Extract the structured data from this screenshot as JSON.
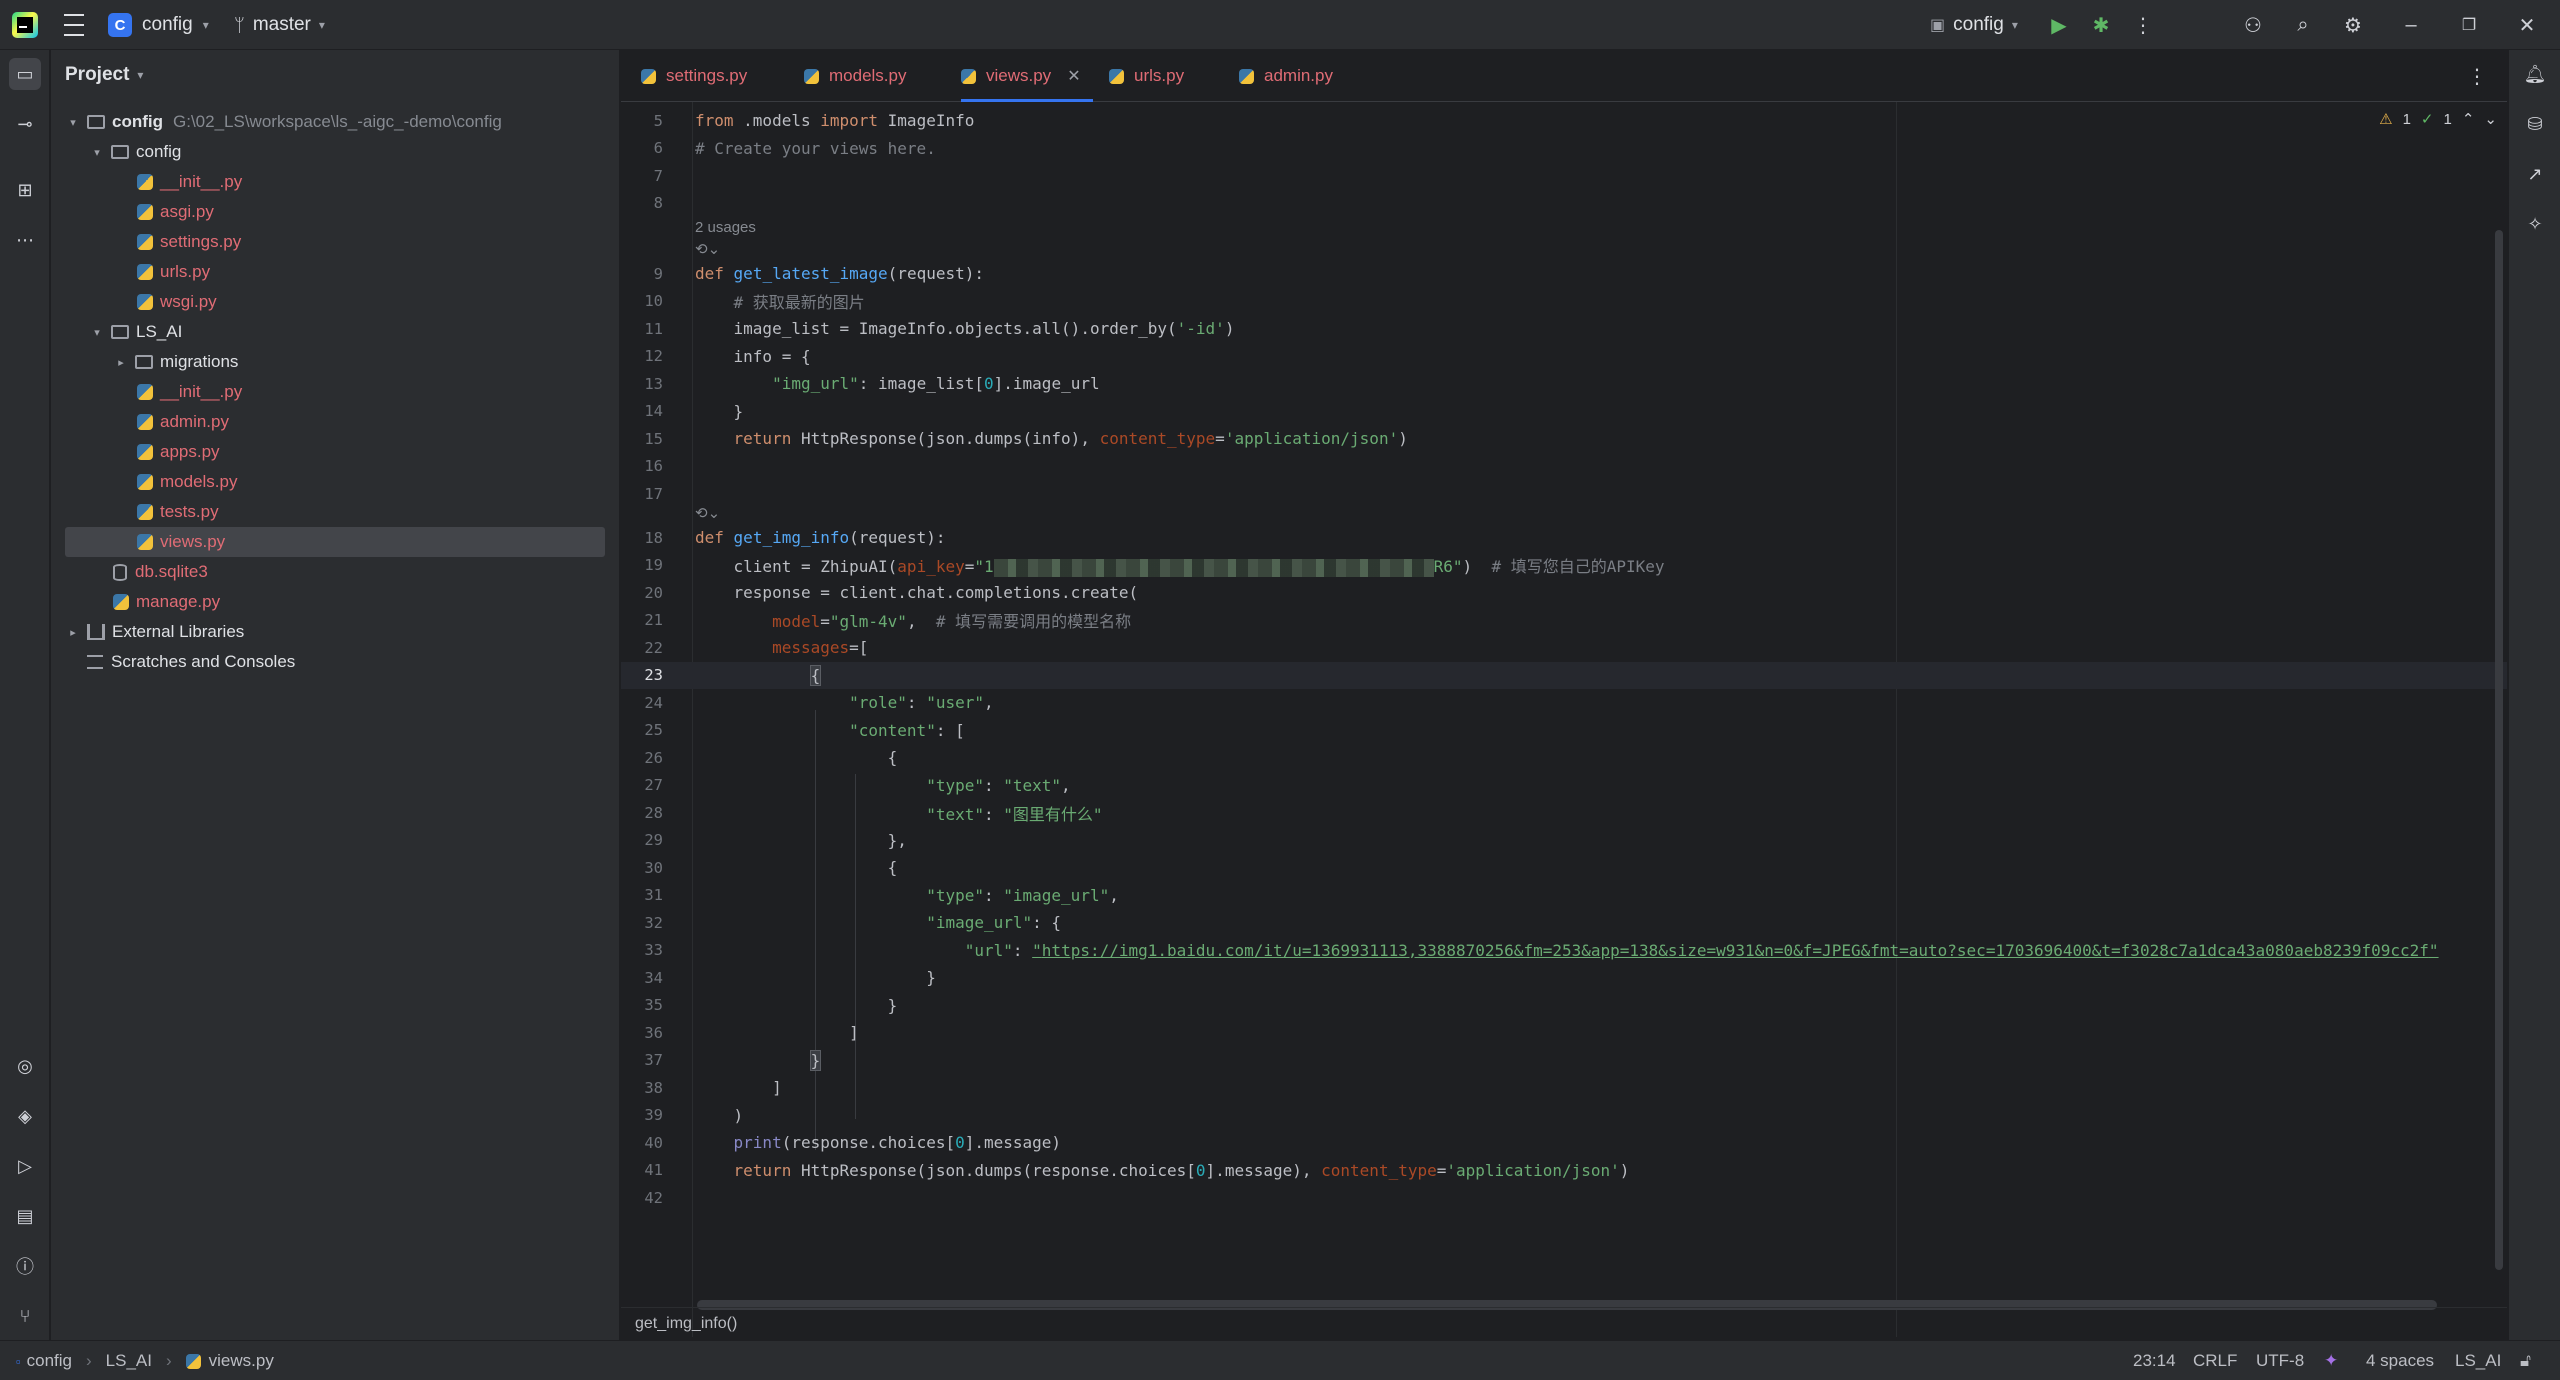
{
  "titlebar": {
    "project_badge": "C",
    "project_name": "config",
    "branch": "master",
    "run_config": "config"
  },
  "project_panel": {
    "title": "Project",
    "tree": [
      {
        "label": "config",
        "extra": "G:\\02_LS\\workspace\\ls_-aigc_-demo\\config",
        "kind": "root"
      },
      {
        "label": "config",
        "kind": "folder"
      },
      {
        "label": "__init__.py",
        "kind": "py"
      },
      {
        "label": "asgi.py",
        "kind": "py"
      },
      {
        "label": "settings.py",
        "kind": "py"
      },
      {
        "label": "urls.py",
        "kind": "py"
      },
      {
        "label": "wsgi.py",
        "kind": "py"
      },
      {
        "label": "LS_AI",
        "kind": "folder"
      },
      {
        "label": "migrations",
        "kind": "folder"
      },
      {
        "label": "__init__.py",
        "kind": "py"
      },
      {
        "label": "admin.py",
        "kind": "py"
      },
      {
        "label": "apps.py",
        "kind": "py"
      },
      {
        "label": "models.py",
        "kind": "py"
      },
      {
        "label": "tests.py",
        "kind": "py"
      },
      {
        "label": "views.py",
        "kind": "py",
        "selected": true
      },
      {
        "label": "db.sqlite3",
        "kind": "db"
      },
      {
        "label": "manage.py",
        "kind": "py"
      },
      {
        "label": "External Libraries",
        "kind": "lib"
      },
      {
        "label": "Scratches and Consoles",
        "kind": "scratch"
      }
    ]
  },
  "tabs": [
    {
      "label": "settings.py"
    },
    {
      "label": "models.py"
    },
    {
      "label": "views.py",
      "active": true
    },
    {
      "label": "urls.py"
    },
    {
      "label": "admin.py"
    }
  ],
  "inspection": {
    "warnings": "1",
    "ok": "1"
  },
  "code": {
    "usages_hint": "2 usages",
    "line_numbers": [
      "5",
      "6",
      "7",
      "8",
      "9",
      "10",
      "11",
      "12",
      "13",
      "14",
      "15",
      "16",
      "17",
      "18",
      "19",
      "20",
      "21",
      "22",
      "23",
      "24",
      "25",
      "26",
      "27",
      "28",
      "29",
      "30",
      "31",
      "32",
      "33",
      "34",
      "35",
      "36",
      "37",
      "38",
      "39",
      "40",
      "41",
      "42"
    ],
    "url": "https://img1.baidu.com/it/u=1369931113,3388870256&fm=253&app=138&size=w931&n=0&f=JPEG&fmt=auto?sec=1703696400&t=f3028c7a1dca43a080aeb8239f09cc2f",
    "comment_cn1": "# 获取最新的图片",
    "comment_cn2": "# 填写您自己的APIKey",
    "comment_cn3": "# 填写需要调用的模型名称",
    "text_cn": "\"图里有什么\"",
    "comment_create": "# Create your views here."
  },
  "breadcrumb_fn": "get_img_info()",
  "statusbar": {
    "path": [
      "config",
      "LS_AI",
      "views.py"
    ],
    "caret": "23:14",
    "line_sep": "CRLF",
    "encoding": "UTF-8",
    "indent": "4 spaces",
    "interpreter": "LS_AI"
  },
  "colors": {
    "accent": "#3574f0",
    "keyword": "#cf8e6d",
    "string": "#6aab73",
    "function": "#56a8f5",
    "vcs_modified": "#e06c75"
  }
}
